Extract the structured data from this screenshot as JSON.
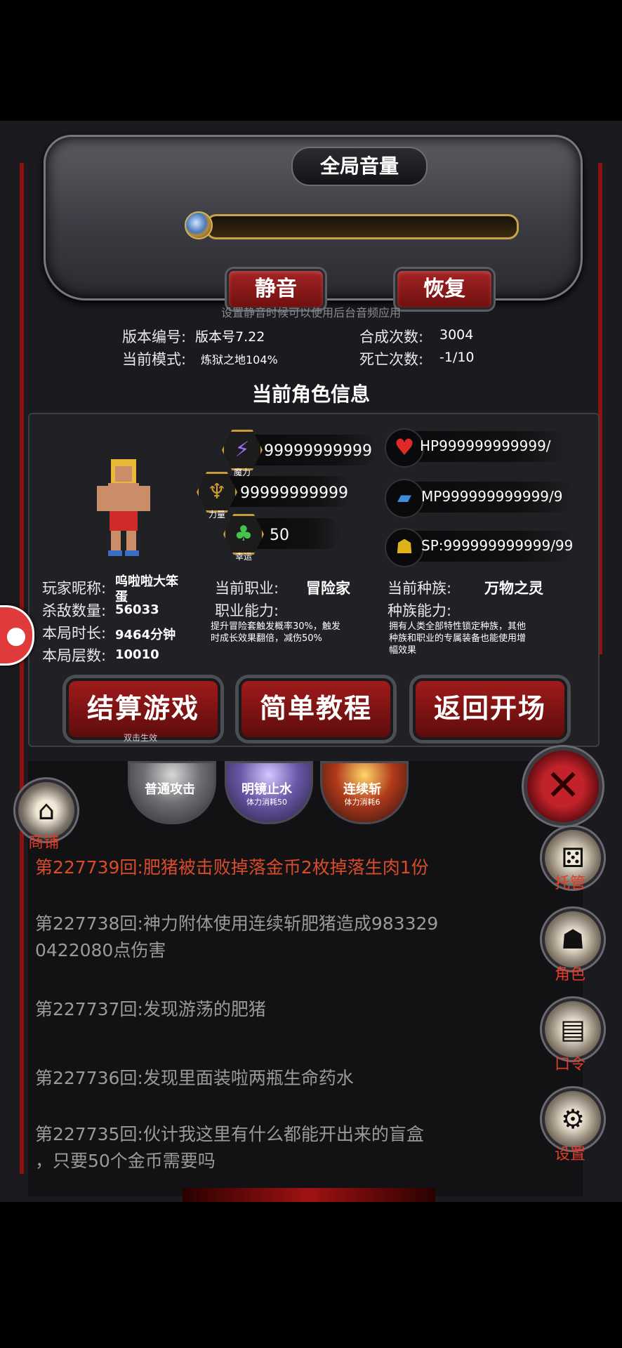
{
  "volume": {
    "title": "全局音量",
    "mute_label": "静音",
    "restore_label": "恢复",
    "hint": "设置静音时候可以使用后台音频应用",
    "level": 0
  },
  "game_info": {
    "version_label": "版本编号:",
    "version_value": "版本号7.22",
    "mode_label": "当前模式:",
    "mode_value": "炼狱之地104%",
    "craft_label": "合成次数:",
    "craft_value": "3004",
    "death_label": "死亡次数:",
    "death_value": "-1/10"
  },
  "char": {
    "title": "当前角色信息",
    "magic_value": "99999999999",
    "magic_cap": "魔力",
    "strength_value": "99999999999",
    "strength_cap": "力量",
    "luck_value": "50",
    "luck_cap": "幸运",
    "hp_text": "HP999999999999/",
    "mp_text": "MP999999999999/9",
    "sp_text": "SP:999999999999/99",
    "nickname_label": "玩家昵称:",
    "nickname_value_1": "呜啦啦大笨",
    "nickname_value_2": "蛋",
    "kills_label": "杀敌数量:",
    "kills_value": "56033",
    "duration_label": "本局时长:",
    "duration_value": "9464分钟",
    "floor_label": "本局层数:",
    "floor_value": "10010",
    "job_label": "当前职业:",
    "job_value": "冒险家",
    "job_ability_label": "职业能力:",
    "job_ability_1": "提升冒险套触发概率30%，触发",
    "job_ability_2": "时成长效果翻倍，减伤50%",
    "race_label": "当前种族:",
    "race_value": "万物之灵",
    "race_ability_label": "种族能力:",
    "race_ability_1": "拥有人类全部特性锁定种族，其他",
    "race_ability_2": "种族和职业的专属装备也能使用增",
    "race_ability_3": "幅效果"
  },
  "actions": {
    "settle_label": "结算游戏",
    "settle_sub": "双击生效",
    "tutorial_label": "简单教程",
    "return_label": "返回开场"
  },
  "skills": [
    {
      "label": "普通攻击",
      "sub": ""
    },
    {
      "label": "明镜止水",
      "sub": "体力消耗50"
    },
    {
      "label": "连续斩",
      "sub": "体力消耗6"
    }
  ],
  "side": {
    "shop_label": "商铺",
    "auto_label": "托管",
    "role_label": "角色",
    "code_label": "口令",
    "settings_label": "设置"
  },
  "log": [
    {
      "text": "第227739回:肥猪被击败掉落金币2枚掉落生肉1份",
      "highlight": true
    },
    {
      "text": "第227738回:神力附体使用连续斩肥猪造成983329",
      "cont": "0422080点伤害",
      "highlight": false
    },
    {
      "text": "第227737回:发现游荡的肥猪",
      "highlight": false
    },
    {
      "text": "第227736回:发现里面装啦两瓶生命药水",
      "highlight": false
    },
    {
      "text": "第227735回:伙计我这里有什么都能开出来的盲盒",
      "cont": "，只要50个金币需要吗",
      "highlight": false
    }
  ],
  "colors": {
    "accent_red": "#a01b1b",
    "log_highlight": "#d94b2a",
    "side_label": "#e23c2a",
    "gold": "#c99a3a"
  }
}
